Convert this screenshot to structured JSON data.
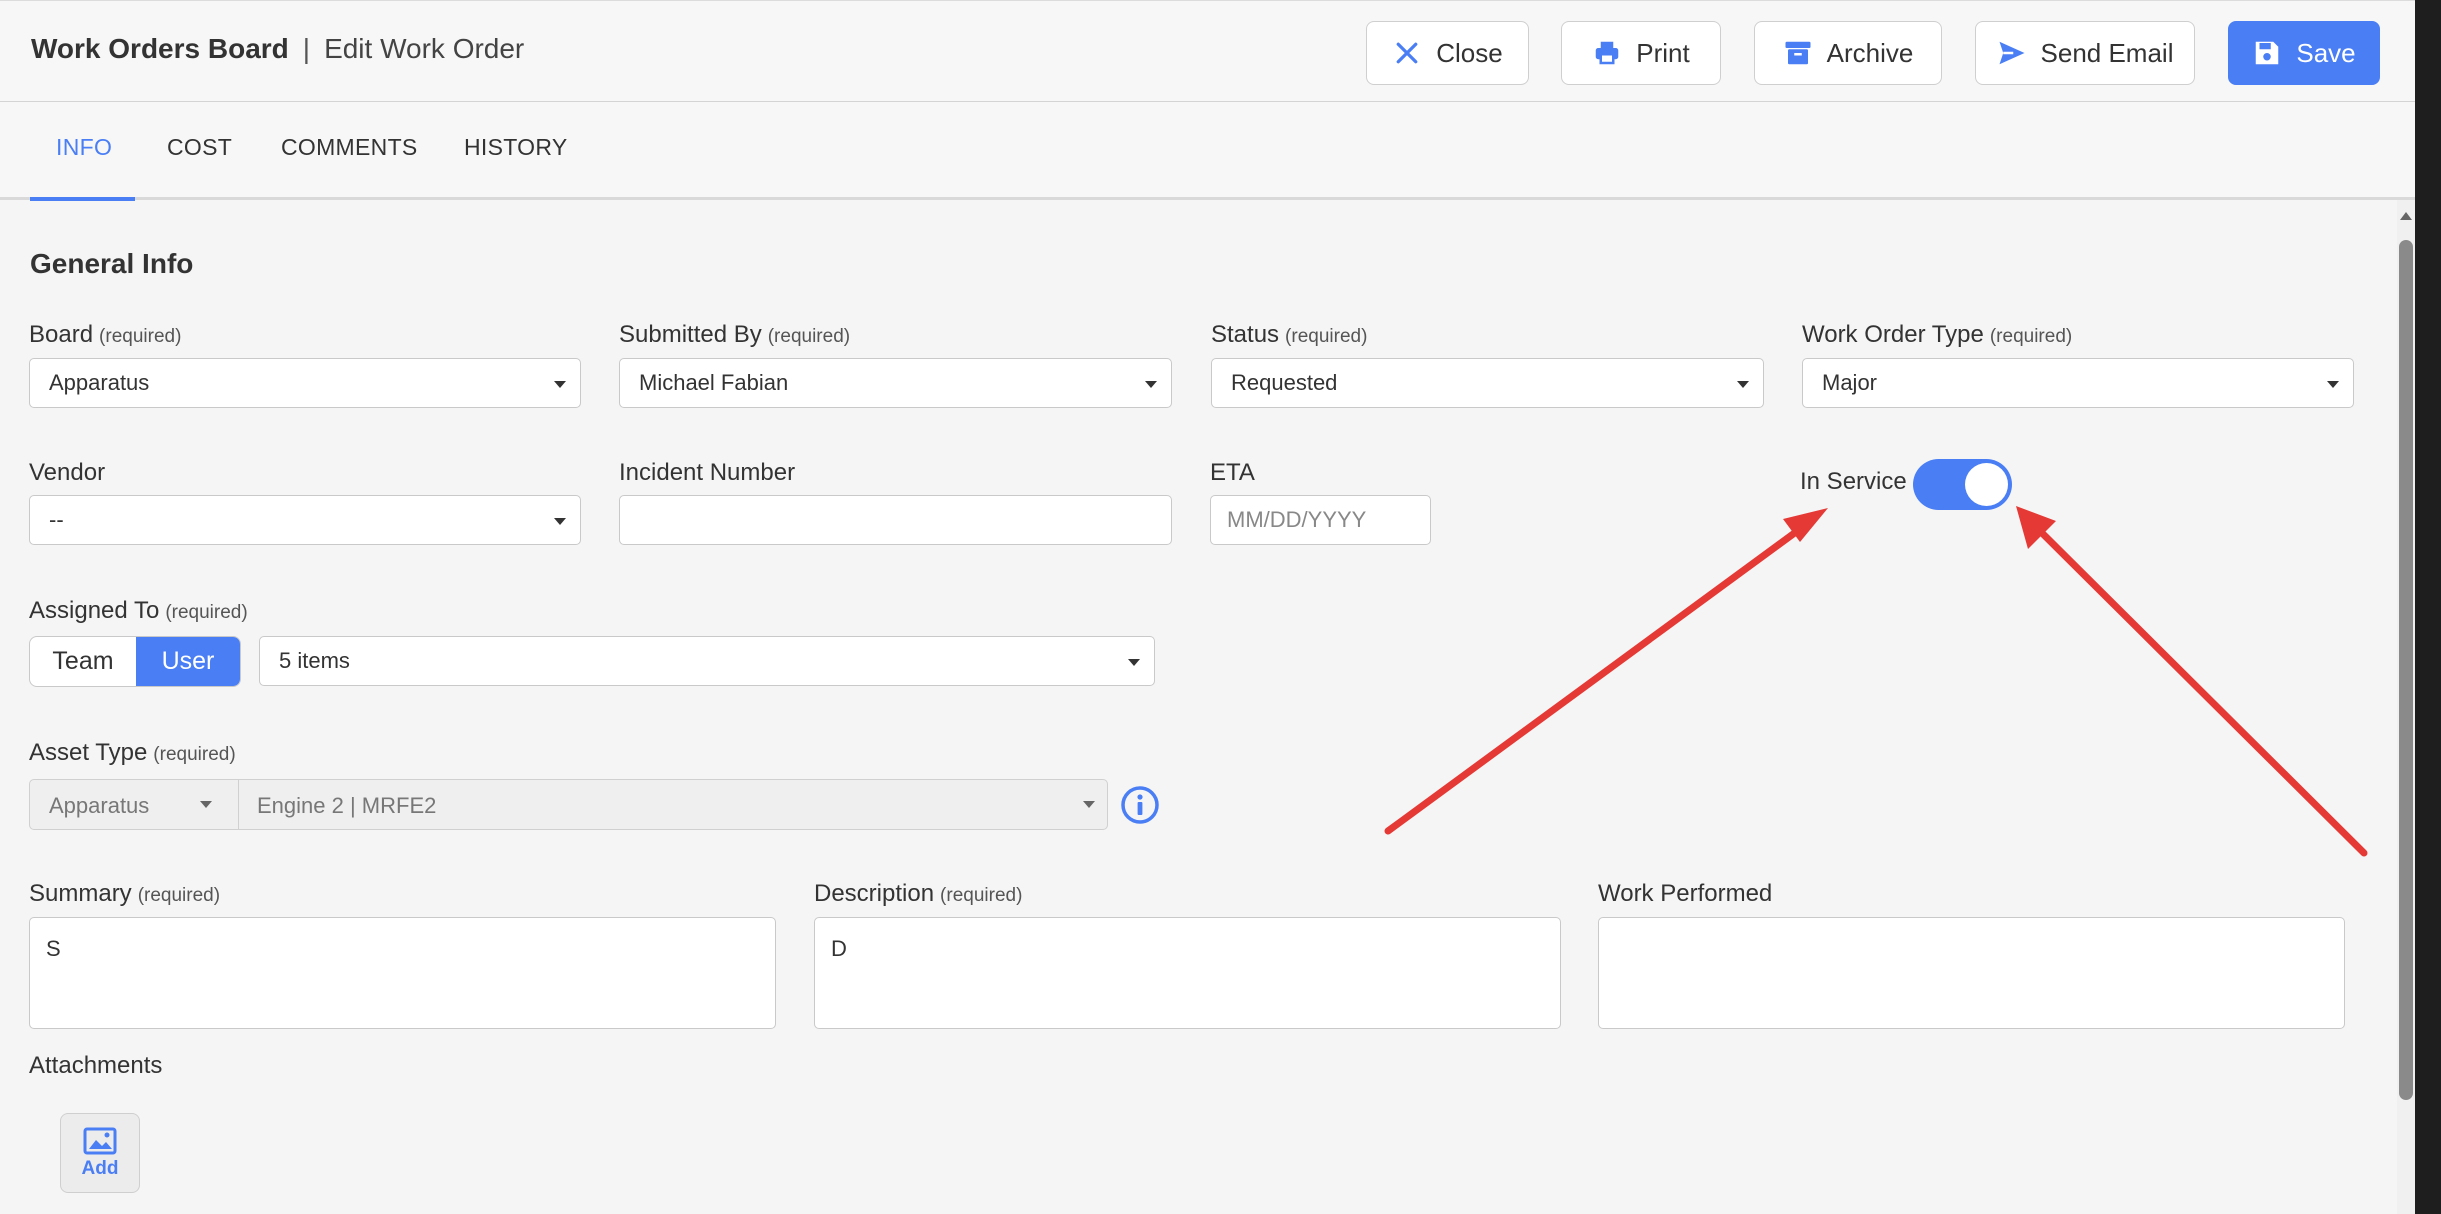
{
  "header": {
    "title": "Work Orders Board",
    "separator": "|",
    "subtitle": "Edit Work Order",
    "buttons": {
      "close": "Close",
      "print": "Print",
      "archive": "Archive",
      "send_email": "Send Email",
      "save": "Save"
    }
  },
  "tabs": [
    "INFO",
    "COST",
    "COMMENTS",
    "HISTORY"
  ],
  "active_tab": "INFO",
  "section": {
    "title": "General Info"
  },
  "fields": {
    "board": {
      "label": "Board",
      "req": "(required)",
      "value": "Apparatus"
    },
    "submitted_by": {
      "label": "Submitted By",
      "req": "(required)",
      "value": "Michael Fabian"
    },
    "status": {
      "label": "Status",
      "req": "(required)",
      "value": "Requested"
    },
    "work_order_type": {
      "label": "Work Order Type",
      "req": "(required)",
      "value": "Major"
    },
    "vendor": {
      "label": "Vendor",
      "value": "--"
    },
    "incident_number": {
      "label": "Incident Number",
      "value": ""
    },
    "eta": {
      "label": "ETA",
      "placeholder": "MM/DD/YYYY"
    },
    "in_service": {
      "label": "In Service",
      "on": true
    },
    "assigned_to": {
      "label": "Assigned To",
      "req": "(required)",
      "options": [
        "Team",
        "User"
      ],
      "selected": "User",
      "value": "5 items"
    },
    "asset_type": {
      "label": "Asset Type",
      "req": "(required)",
      "category": "Apparatus",
      "value": "Engine 2 | MRFE2"
    },
    "summary": {
      "label": "Summary",
      "req": "(required)",
      "value": "S"
    },
    "description": {
      "label": "Description",
      "req": "(required)",
      "value": "D"
    },
    "work_performed": {
      "label": "Work Performed",
      "value": ""
    }
  },
  "attachments": {
    "label": "Attachments",
    "add_label": "Add"
  },
  "colors": {
    "accent": "#4a7ef5",
    "annotation": "#e53935"
  }
}
